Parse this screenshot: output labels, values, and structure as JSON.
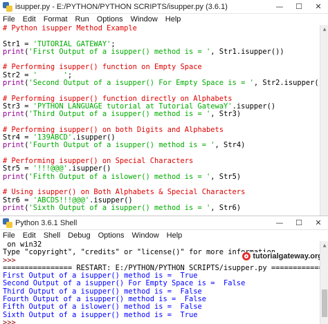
{
  "editor": {
    "title": "isupper.py - E:/PYTHON/PYTHON SCRIPTS/isupper.py (3.6.1)",
    "menu": [
      "File",
      "Edit",
      "Format",
      "Run",
      "Options",
      "Window",
      "Help"
    ],
    "lines": [
      [
        {
          "t": "# Python isupper Method Example",
          "c": "comment"
        }
      ],
      [],
      [
        {
          "t": "Str1 = ",
          "c": "plain"
        },
        {
          "t": "'TUTORIAL GATEWAY'",
          "c": "str"
        },
        {
          "t": ";",
          "c": "plain"
        }
      ],
      [
        {
          "t": "print",
          "c": "builtin"
        },
        {
          "t": "(",
          "c": "plain"
        },
        {
          "t": "'First Output of a isupper() method is = '",
          "c": "str"
        },
        {
          "t": ", Str1.isupper())",
          "c": "plain"
        }
      ],
      [],
      [
        {
          "t": "# Performing isupper() function on Empty Space",
          "c": "comment"
        }
      ],
      [
        {
          "t": "Str2 = ",
          "c": "plain"
        },
        {
          "t": "'      '",
          "c": "str"
        },
        {
          "t": ";",
          "c": "plain"
        }
      ],
      [
        {
          "t": "print",
          "c": "builtin"
        },
        {
          "t": "(",
          "c": "plain"
        },
        {
          "t": "'Second Output of a isupper() For Empty Space is = '",
          "c": "str"
        },
        {
          "t": ", Str2.isupper())",
          "c": "plain"
        }
      ],
      [],
      [
        {
          "t": "# Performing isupper() function directly on Alphabets",
          "c": "comment"
        }
      ],
      [
        {
          "t": "Str3 = ",
          "c": "plain"
        },
        {
          "t": "'PYTHON LANGUAGE tutorial at Tutorial GatewaY'",
          "c": "str"
        },
        {
          "t": ".isupper()",
          "c": "plain"
        }
      ],
      [
        {
          "t": "print",
          "c": "builtin"
        },
        {
          "t": "(",
          "c": "plain"
        },
        {
          "t": "'Third Output of a isupper() method is = '",
          "c": "str"
        },
        {
          "t": ", Str3)",
          "c": "plain"
        }
      ],
      [],
      [
        {
          "t": "# Performing isupper() on both Digits and Alphabets",
          "c": "comment"
        }
      ],
      [
        {
          "t": "Str4 = ",
          "c": "plain"
        },
        {
          "t": "'139ABCD'",
          "c": "str"
        },
        {
          "t": ".isupper()",
          "c": "plain"
        }
      ],
      [
        {
          "t": "print",
          "c": "builtin"
        },
        {
          "t": "(",
          "c": "plain"
        },
        {
          "t": "'Fourth Output of a isupper() method is = '",
          "c": "str"
        },
        {
          "t": ", Str4)",
          "c": "plain"
        }
      ],
      [],
      [
        {
          "t": "# Performing isupper() on Special Characters",
          "c": "comment"
        }
      ],
      [
        {
          "t": "Str5 = ",
          "c": "plain"
        },
        {
          "t": "'!!!@@@'",
          "c": "str"
        },
        {
          "t": ".isupper()",
          "c": "plain"
        }
      ],
      [
        {
          "t": "print",
          "c": "builtin"
        },
        {
          "t": "(",
          "c": "plain"
        },
        {
          "t": "'Fifth Output of a islower() method is = '",
          "c": "str"
        },
        {
          "t": ", Str5)",
          "c": "plain"
        }
      ],
      [],
      [
        {
          "t": "# Using isupper() on Both Alphabets & Special Characters",
          "c": "comment"
        }
      ],
      [
        {
          "t": "Str6 = ",
          "c": "plain"
        },
        {
          "t": "'ABCDS!!!@@@'",
          "c": "str"
        },
        {
          "t": ".isupper()",
          "c": "plain"
        }
      ],
      [
        {
          "t": "print",
          "c": "builtin"
        },
        {
          "t": "(",
          "c": "plain"
        },
        {
          "t": "'Sixth Output of a isupper() method is = '",
          "c": "str"
        },
        {
          "t": ", Str6)",
          "c": "plain"
        }
      ]
    ]
  },
  "shell": {
    "title": "Python 3.6.1 Shell",
    "menu": [
      "File",
      "Edit",
      "Shell",
      "Debug",
      "Options",
      "Window",
      "Help"
    ],
    "watermark": "tutorialgateway.org",
    "lines": [
      [
        {
          "t": " on win32",
          "c": "plain"
        }
      ],
      [
        {
          "t": "Type \"copyright\", \"credits\" or \"license()\" for more information.",
          "c": "plain"
        }
      ],
      [
        {
          "t": ">>> ",
          "c": "prompt"
        }
      ],
      [
        {
          "t": "================ RESTART: E:/PYTHON/PYTHON SCRIPTS/isupper.py ================",
          "c": "plain"
        }
      ],
      [
        {
          "t": "First Output of a isupper() method is =  True",
          "c": "out"
        }
      ],
      [
        {
          "t": "Second Output of a isupper() For Empty Space is =  False",
          "c": "out"
        }
      ],
      [
        {
          "t": "Third Output of a isupper() method is =  False",
          "c": "out"
        }
      ],
      [
        {
          "t": "Fourth Output of a isupper() method is =  False",
          "c": "out"
        }
      ],
      [
        {
          "t": "Fifth Output of a islower() method is =  False",
          "c": "out"
        }
      ],
      [
        {
          "t": "Sixth Output of a isupper() method is =  True",
          "c": "out"
        }
      ],
      [
        {
          "t": ">>> ",
          "c": "prompt"
        }
      ]
    ]
  },
  "window_buttons": {
    "minimize": "—",
    "maximize": "☐",
    "close": "✕"
  },
  "colors": {
    "comment": "#dd0000",
    "string": "#00aa00",
    "builtin": "#900090",
    "output": "#0000ff"
  }
}
